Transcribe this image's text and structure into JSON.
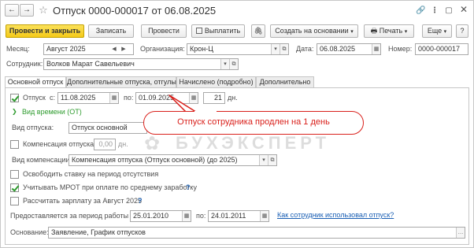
{
  "window": {
    "title": "Отпуск 0000-000017 от 06.08.2025"
  },
  "toolbar": {
    "post_close": "Провести и закрыть",
    "save": "Записать",
    "post": "Провести",
    "pay": "Выплатить",
    "create_based": "Создать на основании",
    "print": "Печать",
    "more": "Еще"
  },
  "header": {
    "month_label": "Месяц:",
    "month_value": "Август 2025",
    "org_label": "Организация:",
    "org_value": "Крон-Ц",
    "date_label": "Дата:",
    "date_value": "06.08.2025",
    "number_label": "Номер:",
    "number_value": "0000-000017",
    "employee_label": "Сотрудник:",
    "employee_value": "Волков Марат Савельевич"
  },
  "tabs": [
    {
      "label": "Основной отпуск",
      "active": true
    },
    {
      "label": "Дополнительные отпуска, отгулы",
      "active": false
    },
    {
      "label": "Начислено (подробно)",
      "active": false
    },
    {
      "label": "Дополнительно",
      "active": false
    }
  ],
  "vacation": {
    "checkbox_label": "Отпуск",
    "from_label": "с:",
    "from_value": "11.08.2025",
    "to_label": "по:",
    "to_value": "01.09.2025",
    "days_value": "21",
    "days_unit": "дн.",
    "time_type_link": "Вид времени (ОТ)",
    "type_label": "Вид отпуска:",
    "type_value": "Отпуск основной",
    "compensation_label": "Компенсация отпуска",
    "compensation_value": "0,00",
    "compensation_unit": "дн.",
    "compensation_kind_label": "Вид компенсации:",
    "compensation_kind_value": "Компенсация отпуска (Отпуск основной) (до 2025)",
    "free_rate_label": "Освободить ставку на период отсутствия",
    "mrot_label": "Учитывать МРОТ при оплате по среднему заработку",
    "salary_label": "Рассчитать зарплату за Август 2025"
  },
  "work_period": {
    "label": "Предоставляется за период работы с:",
    "from_value": "25.01.2010",
    "to_label": "по:",
    "to_value": "24.01.2011",
    "link": "Как сотрудник использовал отпуск?"
  },
  "basis": {
    "label": "Основание:",
    "value": "Заявление, График отпусков"
  },
  "callout": {
    "text": "Отпуск сотрудника продлен на 1 день"
  },
  "watermark": {
    "text": "БУХЭКСПЕРТ"
  },
  "help_mark": "?",
  "colors": {
    "primary_button": "#f5ca19",
    "link": "#1a5fb4",
    "callout_border": "#d9201b",
    "green": "#2e9b2e"
  }
}
